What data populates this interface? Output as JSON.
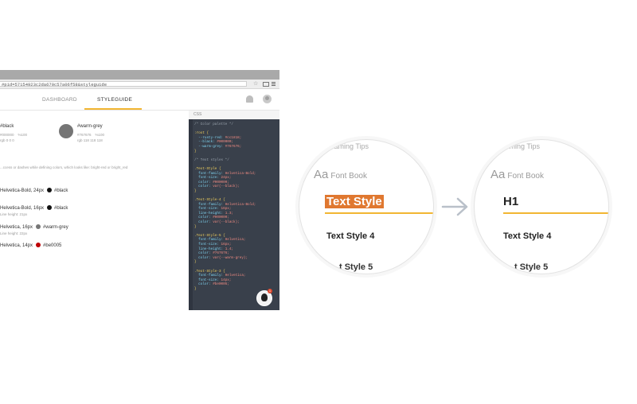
{
  "browser": {
    "url": "#pid=57154923c2da670c57a06f58&styleguide",
    "tabs": [
      "DASHBOARD",
      "STYLEGUIDE"
    ]
  },
  "palette": [
    {
      "name": "#black",
      "meta": "#000000    %100\nrgb 0 0 0"
    },
    {
      "name": "#warm-grey",
      "meta": "#767676    %100\nrgb 118 118 118"
    }
  ],
  "palette_note": "...ccess or dashes while defining colors, which looks like: bright-red or bright_red",
  "text_styles": [
    {
      "label": "Helvetica-Bold, 24px",
      "swatch": "#black",
      "dot_color": "#111111",
      "sub": ""
    },
    {
      "label": "Helvetica-Bold, 16px",
      "swatch": "#black",
      "dot_color": "#111111",
      "sub": "Line height: 21px"
    },
    {
      "label": "Helvetica, 16px",
      "swatch": "#warm-grey",
      "dot_color": "#767676",
      "sub": "Line height: 22px"
    },
    {
      "label": "Helvetica, 14px",
      "swatch": "#be0005",
      "dot_color": "#be0005",
      "sub": ""
    }
  ],
  "css_panel": {
    "title": "CSS",
    "code": [
      {
        "t": "cm",
        "s": "/* Color palette */"
      },
      {
        "t": "",
        "s": ""
      },
      {
        "t": "sel",
        "s": ":root {"
      },
      {
        "t": "kv",
        "k": "  --rusty-red: ",
        "v": "#cc1818;"
      },
      {
        "t": "kv",
        "k": "  --black: ",
        "v": "#000000;"
      },
      {
        "t": "kv",
        "k": "  --warm-grey: ",
        "v": "#767676;"
      },
      {
        "t": "sel",
        "s": "}"
      },
      {
        "t": "",
        "s": ""
      },
      {
        "t": "cm",
        "s": "/* Text styles */"
      },
      {
        "t": "",
        "s": ""
      },
      {
        "t": "sel",
        "s": ".Text-Style {"
      },
      {
        "t": "kv",
        "k": "  font-family: ",
        "v": "Helvetica-Bold;"
      },
      {
        "t": "kv",
        "k": "  font-size: ",
        "v": "24px;"
      },
      {
        "t": "kv",
        "k": "  color: ",
        "v": "#000000;"
      },
      {
        "t": "kv",
        "k": "  color: ",
        "v": "var(--black);"
      },
      {
        "t": "sel",
        "s": "}"
      },
      {
        "t": "",
        "s": ""
      },
      {
        "t": "sel",
        "s": ".Text-Style-4 {"
      },
      {
        "t": "kv",
        "k": "  font-family: ",
        "v": "Helvetica-Bold;"
      },
      {
        "t": "kv",
        "k": "  font-size: ",
        "v": "16px;"
      },
      {
        "t": "kv",
        "k": "  line-height: ",
        "v": "1.3;"
      },
      {
        "t": "kv",
        "k": "  color: ",
        "v": "#000000;"
      },
      {
        "t": "kv",
        "k": "  color: ",
        "v": "var(--black);"
      },
      {
        "t": "sel",
        "s": "}"
      },
      {
        "t": "",
        "s": ""
      },
      {
        "t": "sel",
        "s": ".Text-Style-5 {"
      },
      {
        "t": "kv",
        "k": "  font-family: ",
        "v": "Helvetica;"
      },
      {
        "t": "kv",
        "k": "  font-size: ",
        "v": "16px;"
      },
      {
        "t": "kv",
        "k": "  line-height: ",
        "v": "1.4;"
      },
      {
        "t": "kv",
        "k": "  color: ",
        "v": "#767676;"
      },
      {
        "t": "kv",
        "k": "  color: ",
        "v": "var(--warm-grey);"
      },
      {
        "t": "sel",
        "s": "}"
      },
      {
        "t": "",
        "s": ""
      },
      {
        "t": "sel",
        "s": ".Text-Style-3 {"
      },
      {
        "t": "kv",
        "k": "  font-family: ",
        "v": "Helvetica;"
      },
      {
        "t": "kv",
        "k": "  font-size: ",
        "v": "14px;"
      },
      {
        "t": "kv",
        "k": "  color: ",
        "v": "#be0005;"
      },
      {
        "t": "sel",
        "s": "}"
      }
    ],
    "notification_count": "1"
  },
  "zoom_left": {
    "top_text": "...aming Tips",
    "aa": "Aa",
    "font_book": "Font Book",
    "main": "Text Style",
    "style4": "Text Style 4",
    "style5": "t Style 5"
  },
  "zoom_right": {
    "top_text": "...ming Tips",
    "aa": "Aa",
    "font_book": "Font Book",
    "main": "H1",
    "style4": "Text Style 4",
    "style5": "t Style 5"
  },
  "colors": {
    "accent": "#f2b632",
    "selection": "#e07830",
    "code_bg": "#39404b"
  }
}
